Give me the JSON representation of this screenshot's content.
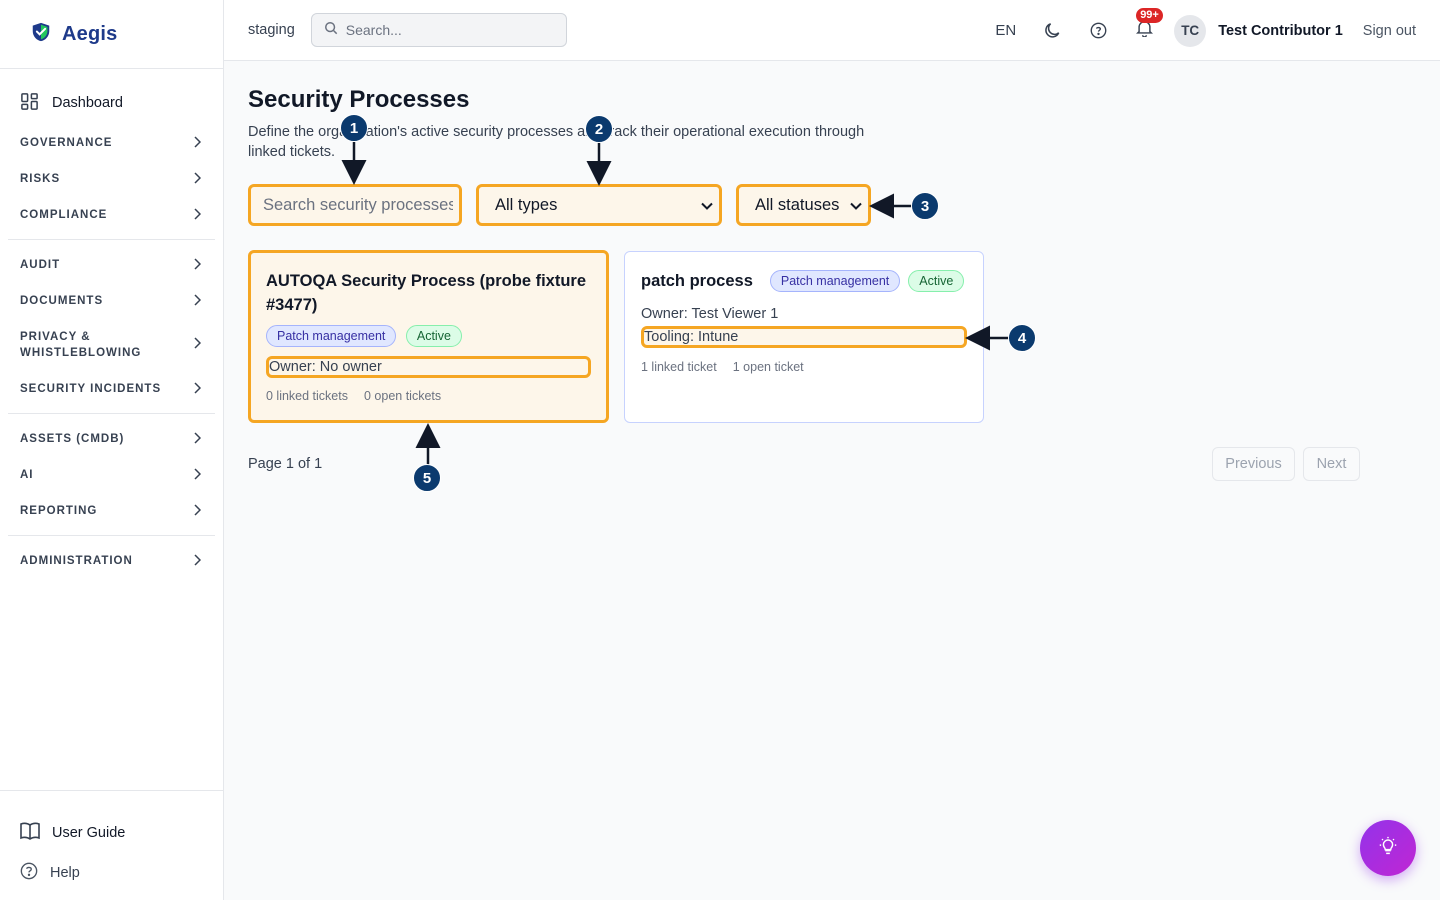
{
  "app": {
    "name": "Aegis"
  },
  "sidebar": {
    "dashboard": "Dashboard",
    "groups": [
      {
        "label": "GOVERNANCE"
      },
      {
        "label": "RISKS"
      },
      {
        "label": "COMPLIANCE"
      },
      {
        "label": "AUDIT"
      },
      {
        "label": "DOCUMENTS"
      },
      {
        "label": "PRIVACY & WHISTLEBLOWING"
      },
      {
        "label": "SECURITY INCIDENTS"
      },
      {
        "label": "ASSETS (CMDB)"
      },
      {
        "label": "AI"
      },
      {
        "label": "REPORTING"
      },
      {
        "label": "ADMINISTRATION"
      }
    ],
    "user_guide": "User Guide",
    "help": "Help"
  },
  "topbar": {
    "environment": "staging",
    "search_placeholder": "Search...",
    "language": "EN",
    "notification_count": "99+",
    "avatar_initials": "TC",
    "user_name": "Test Contributor 1",
    "sign_out": "Sign out"
  },
  "page": {
    "title": "Security Processes",
    "subtitle": "Define the organization's active security processes and track their operational execution through linked tickets."
  },
  "filters": {
    "search_placeholder": "Search security processes",
    "type_selected": "All types",
    "status_selected": "All statuses"
  },
  "cards": [
    {
      "title": "AUTOQA Security Process (probe fixture #3477)",
      "type_tag": "Patch management",
      "status_tag": "Active",
      "owner": "Owner: No owner",
      "linked": "0 linked tickets",
      "open": "0 open tickets"
    },
    {
      "title": "patch process",
      "type_tag": "Patch management",
      "status_tag": "Active",
      "owner": "Owner: Test Viewer 1",
      "tooling": "Tooling: Intune",
      "linked": "1 linked ticket",
      "open": "1 open ticket"
    }
  ],
  "pagination": {
    "summary": "Page 1 of 1",
    "previous": "Previous",
    "next": "Next"
  },
  "annotations": [
    "1",
    "2",
    "3",
    "4",
    "5"
  ],
  "colors": {
    "highlight": "#f5a623",
    "marker": "#0b3a6e",
    "brand": "#1e3a8a",
    "fab": "#9333ea"
  },
  "icons": [
    "shield-logo-icon",
    "dashboard-grid-icon",
    "chevron-right-icon",
    "book-icon",
    "help-circle-icon",
    "search-icon",
    "moon-icon",
    "question-circle-icon",
    "bell-icon",
    "chevron-down-icon",
    "lightbulb-icon"
  ]
}
